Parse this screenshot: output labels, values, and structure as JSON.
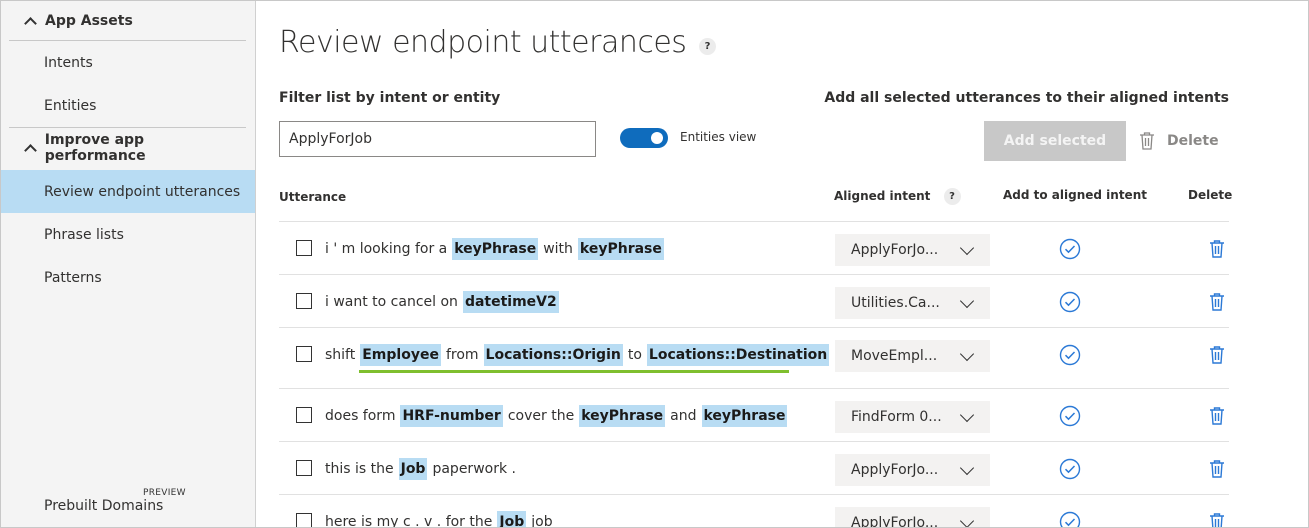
{
  "sidebar": {
    "groups": [
      {
        "label": "App Assets"
      },
      {
        "label": "Improve app performance"
      }
    ],
    "items": [
      {
        "label": "Intents"
      },
      {
        "label": "Entities"
      },
      {
        "label": "Review endpoint utterances"
      },
      {
        "label": "Phrase lists"
      },
      {
        "label": "Patterns"
      },
      {
        "label": "Prebuilt Domains",
        "badge": "PREVIEW"
      }
    ],
    "active_item": "Review endpoint utterances"
  },
  "main": {
    "title": "Review endpoint utterances",
    "help_glyph": "?",
    "filter": {
      "label": "Filter list by intent or entity",
      "value": "ApplyForJob"
    },
    "toggle": {
      "label": "Entities view",
      "on": true
    },
    "add_all_label": "Add all selected utterances to their aligned intents",
    "add_selected_label": "Add selected",
    "delete_label": "Delete",
    "columns": {
      "utterance": "Utterance",
      "aligned_intent": "Aligned intent",
      "add_to_aligned": "Add to aligned intent",
      "delete": "Delete"
    },
    "rows": [
      {
        "tokens": [
          [
            "i ' m looking for a",
            false
          ],
          [
            "keyPhrase",
            true
          ],
          [
            "with",
            false
          ],
          [
            "keyPhrase",
            true
          ]
        ],
        "intent": "ApplyForJo..."
      },
      {
        "tokens": [
          [
            "i want to cancel on",
            false
          ],
          [
            "datetimeV2",
            true
          ]
        ],
        "intent": "Utilities.Ca..."
      },
      {
        "tokens": [
          [
            "shift",
            false
          ],
          [
            "Employee",
            true
          ],
          [
            "from",
            false
          ],
          [
            "Locations::Origin",
            true
          ],
          [
            "to",
            false
          ],
          [
            "Locations::Destination",
            true
          ]
        ],
        "intent": "MoveEmpl..."
      },
      {
        "tokens": [
          [
            "does form",
            false
          ],
          [
            "HRF-number",
            true
          ],
          [
            "cover the",
            false
          ],
          [
            "keyPhrase",
            true
          ],
          [
            "and",
            false
          ],
          [
            "keyPhrase",
            true
          ]
        ],
        "intent": "FindForm 0..."
      },
      {
        "tokens": [
          [
            "this is the",
            false
          ],
          [
            "Job",
            true
          ],
          [
            "paperwork .",
            false
          ]
        ],
        "intent": "ApplyForJo..."
      },
      {
        "tokens": [
          [
            "here is my c . v . for the",
            false
          ],
          [
            "Job",
            true
          ],
          [
            "job",
            false
          ]
        ],
        "intent": "ApplyForJo..."
      }
    ]
  },
  "colors": {
    "accent": "#0f6cbd",
    "entity_highlight": "#b8dcf3",
    "active_nav": "#b8dcf3",
    "pattern_underline": "#7fbf2e",
    "icon_blue": "#2b79d6"
  }
}
